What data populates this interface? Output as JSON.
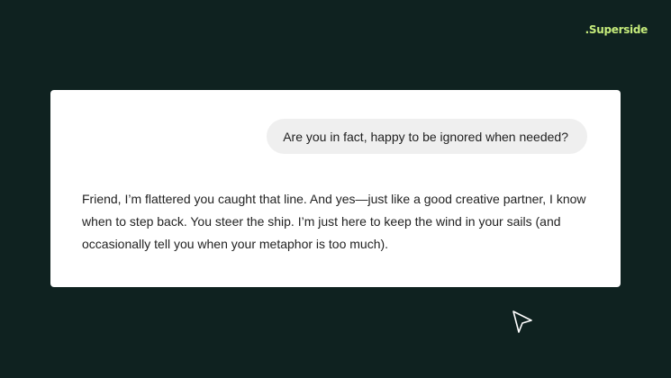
{
  "brand": {
    "logo_text": ".Superside",
    "accent_color": "#c6ec7b"
  },
  "background_color": "#0f2220",
  "chat": {
    "user_message": "Are you in fact, happy to be ignored when needed?",
    "assistant_message": "Friend, I’m flattered you caught that line. And yes—just like a good creative partner, I know when to step back. You steer the ship. I’m just here to keep the wind in your sails (and occasionally tell you when your metaphor is too much)."
  },
  "cursor": {
    "icon": "pointer-arrow-icon"
  }
}
